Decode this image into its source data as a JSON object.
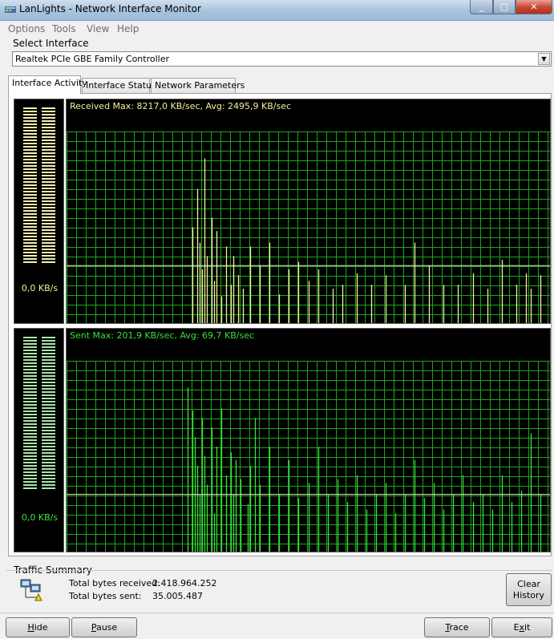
{
  "window": {
    "title": "LanLights - Network Interface Monitor",
    "minimize": "_",
    "maximize": "□",
    "close": "✕"
  },
  "menu": {
    "options": "Options",
    "tools": "Tools",
    "view": "View",
    "help": "Help"
  },
  "interface": {
    "label": "Select Interface",
    "selected": "Realtek PCIe GBE Family Controller"
  },
  "tabs": [
    {
      "label": "Interface Activity",
      "active": true
    },
    {
      "label": "Interface Status",
      "active": false
    },
    {
      "label": "Network Parameters",
      "active": false
    }
  ],
  "received": {
    "meter_value": "0,0 KB/s",
    "header": "Received Max: 8217,0 KB/sec, Avg: 2495,9 KB/sec",
    "color": "#f4f09a",
    "grid_color": "#1ea51e",
    "avg_fraction": 0.3,
    "spikes": [
      [
        0.26,
        0.5
      ],
      [
        0.27,
        0.7
      ],
      [
        0.275,
        0.42
      ],
      [
        0.28,
        0.28
      ],
      [
        0.285,
        0.86
      ],
      [
        0.29,
        0.35
      ],
      [
        0.3,
        0.55
      ],
      [
        0.305,
        0.22
      ],
      [
        0.31,
        0.48
      ],
      [
        0.32,
        0.14
      ],
      [
        0.33,
        0.4
      ],
      [
        0.34,
        0.2
      ],
      [
        0.345,
        0.35
      ],
      [
        0.355,
        0.25
      ],
      [
        0.365,
        0.18
      ],
      [
        0.38,
        0.4
      ],
      [
        0.4,
        0.3
      ],
      [
        0.42,
        0.42
      ],
      [
        0.44,
        0.15
      ],
      [
        0.46,
        0.28
      ],
      [
        0.48,
        0.32
      ],
      [
        0.5,
        0.22
      ],
      [
        0.52,
        0.28
      ],
      [
        0.55,
        0.18
      ],
      [
        0.57,
        0.2
      ],
      [
        0.6,
        0.26
      ],
      [
        0.63,
        0.2
      ],
      [
        0.66,
        0.25
      ],
      [
        0.7,
        0.2
      ],
      [
        0.72,
        0.42
      ],
      [
        0.75,
        0.3
      ],
      [
        0.78,
        0.2
      ],
      [
        0.81,
        0.2
      ],
      [
        0.84,
        0.26
      ],
      [
        0.87,
        0.18
      ],
      [
        0.9,
        0.33
      ],
      [
        0.93,
        0.2
      ],
      [
        0.95,
        0.26
      ],
      [
        0.96,
        0.18
      ],
      [
        0.98,
        0.25
      ]
    ]
  },
  "sent": {
    "meter_value": "0,0 KB/s",
    "header": "Sent Max: 201,9 KB/sec, Avg: 69,7 KB/sec",
    "color": "#3ae23a",
    "grid_color": "#1ea51e",
    "avg_fraction": 0.3,
    "spikes": [
      [
        0.25,
        0.86
      ],
      [
        0.26,
        0.74
      ],
      [
        0.265,
        0.6
      ],
      [
        0.27,
        0.45
      ],
      [
        0.275,
        0.3
      ],
      [
        0.28,
        0.7
      ],
      [
        0.285,
        0.5
      ],
      [
        0.29,
        0.35
      ],
      [
        0.3,
        0.65
      ],
      [
        0.305,
        0.2
      ],
      [
        0.31,
        0.55
      ],
      [
        0.32,
        0.75
      ],
      [
        0.33,
        0.4
      ],
      [
        0.34,
        0.52
      ],
      [
        0.345,
        0.3
      ],
      [
        0.35,
        0.48
      ],
      [
        0.36,
        0.38
      ],
      [
        0.375,
        0.25
      ],
      [
        0.38,
        0.45
      ],
      [
        0.39,
        0.7
      ],
      [
        0.4,
        0.35
      ],
      [
        0.42,
        0.55
      ],
      [
        0.44,
        0.3
      ],
      [
        0.46,
        0.48
      ],
      [
        0.48,
        0.28
      ],
      [
        0.5,
        0.36
      ],
      [
        0.52,
        0.55
      ],
      [
        0.54,
        0.3
      ],
      [
        0.56,
        0.38
      ],
      [
        0.58,
        0.26
      ],
      [
        0.6,
        0.4
      ],
      [
        0.62,
        0.22
      ],
      [
        0.64,
        0.3
      ],
      [
        0.66,
        0.36
      ],
      [
        0.68,
        0.2
      ],
      [
        0.7,
        0.3
      ],
      [
        0.72,
        0.48
      ],
      [
        0.74,
        0.28
      ],
      [
        0.76,
        0.36
      ],
      [
        0.78,
        0.22
      ],
      [
        0.8,
        0.3
      ],
      [
        0.82,
        0.4
      ],
      [
        0.84,
        0.26
      ],
      [
        0.86,
        0.3
      ],
      [
        0.88,
        0.22
      ],
      [
        0.9,
        0.4
      ],
      [
        0.92,
        0.26
      ],
      [
        0.94,
        0.32
      ],
      [
        0.96,
        0.62
      ],
      [
        0.98,
        0.3
      ]
    ]
  },
  "summary": {
    "label": "Traffic Summary",
    "received_label": "Total bytes received:",
    "received_value": "2.418.964.252",
    "sent_label": "Total bytes sent:",
    "sent_value": "35.005.487",
    "clear_line1": "Clear",
    "clear_line2": "History"
  },
  "buttons": {
    "hide_first": "H",
    "hide_rest": "ide",
    "pause_first": "P",
    "pause_rest": "ause",
    "trace_first": "T",
    "trace_rest": "race",
    "exit_first": "E",
    "exit_mid": "x",
    "exit_rest": "it"
  }
}
